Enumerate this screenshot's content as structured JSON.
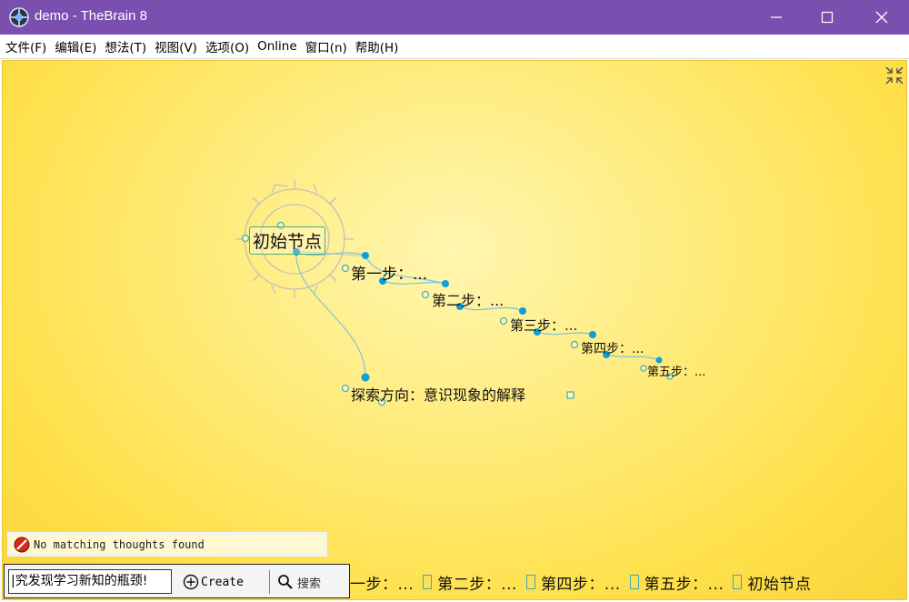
{
  "window": {
    "title": "demo - TheBrain 8"
  },
  "menu": [
    "文件(F)",
    "编辑(E)",
    "想法(T)",
    "视图(V)",
    "选项(O)",
    "Online",
    "窗口(n)",
    "帮助(H)"
  ],
  "graph": {
    "root": "初始节点",
    "children": [
      "第一步：...",
      "第二步：...",
      "第三步：...",
      "第四步：...",
      "第五步：..."
    ],
    "jump": "探索方向：意识现象的解释"
  },
  "status": {
    "message": "No matching thoughts found"
  },
  "toolbar": {
    "input_value": "|究发现学习新知的瓶颈!",
    "create_label": "Create",
    "search_label": "搜索"
  },
  "history": [
    "一步：...",
    "第二步：...",
    "第四步：...",
    "第五步：...",
    "初始节点"
  ],
  "colors": {
    "titlebar": "#7a4fb0",
    "canvas": "#ffe04a",
    "link": "#7fc4d8",
    "node_dot": "#0aa0d8"
  }
}
